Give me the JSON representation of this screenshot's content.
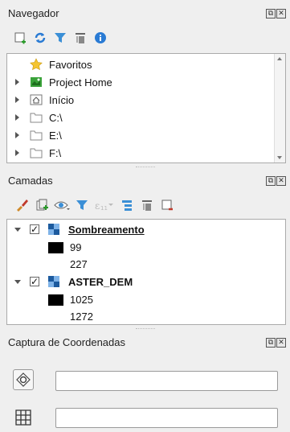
{
  "navigator": {
    "title": "Navegador",
    "items": [
      {
        "label": "Favoritos",
        "icon": "star-icon"
      },
      {
        "label": "Project Home",
        "icon": "project-home-icon"
      },
      {
        "label": "Início",
        "icon": "home-folder-icon"
      },
      {
        "label": "C:\\",
        "icon": "folder-icon"
      },
      {
        "label": "E:\\",
        "icon": "folder-icon"
      },
      {
        "label": "F:\\",
        "icon": "folder-icon"
      }
    ]
  },
  "layers": {
    "title": "Camadas",
    "items": [
      {
        "label": "Sombreamento",
        "checked": true,
        "expanded": true,
        "legend": [
          {
            "label": "99",
            "color": "#000000"
          },
          {
            "label": "227",
            "color": "#ffffff"
          }
        ]
      },
      {
        "label": "ASTER_DEM",
        "checked": true,
        "expanded": true,
        "legend": [
          {
            "label": "1025",
            "color": "#000000"
          },
          {
            "label": "1272",
            "color": "#ffffff"
          }
        ]
      }
    ],
    "checkmark": "✓"
  },
  "coords": {
    "title": "Captura de Coordenadas"
  },
  "dock_buttons": {
    "float": "⧉",
    "close": "✕"
  },
  "colors": {
    "accent_blue": "#2a7bd4",
    "filter_blue": "#3b8fd6",
    "folder": "#e8d9a8"
  }
}
